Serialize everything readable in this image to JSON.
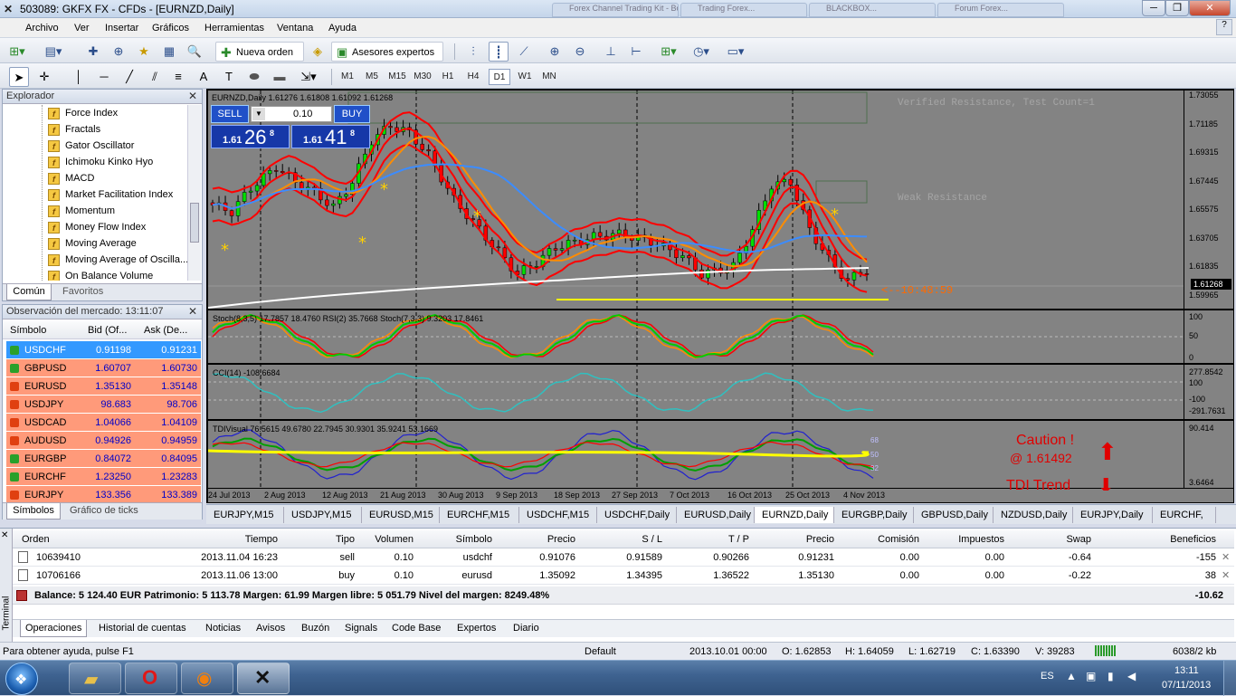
{
  "window": {
    "title": "503089: GKFX FX - CFDs - [EURNZD,Daily]",
    "bg_tabs": [
      "Forex Channel Trading Kit - Bo...",
      "Trading Forex...",
      "BLACKBOX...",
      "Forum Forex..."
    ],
    "controls": {
      "minimize": "─",
      "restore": "❐",
      "close": "✕"
    }
  },
  "menu": [
    "Archivo",
    "Ver",
    "Insertar",
    "Gráficos",
    "Herramientas",
    "Ventana",
    "Ayuda"
  ],
  "toolbar": {
    "new_order": "Nueva orden",
    "expert_advisors": "Asesores expertos"
  },
  "timeframes": [
    "M1",
    "M5",
    "M15",
    "M30",
    "H1",
    "H4",
    "D1",
    "W1",
    "MN"
  ],
  "active_timeframe": "D1",
  "navigator": {
    "title": "Explorador",
    "items": [
      "Force Index",
      "Fractals",
      "Gator Oscillator",
      "Ichimoku Kinko Hyo",
      "MACD",
      "Market Facilitation Index",
      "Momentum",
      "Money Flow Index",
      "Moving Average",
      "Moving Average of Oscilla...",
      "On Balance Volume"
    ],
    "tabs": [
      "Común",
      "Favoritos"
    ]
  },
  "market_watch": {
    "title": "Observación del mercado: 13:11:07",
    "headers": {
      "symbol": "Símbolo",
      "bid": "Bid (Of...",
      "ask": "Ask (De..."
    },
    "rows": [
      {
        "symbol": "USDCHF",
        "bid": "0.91198",
        "ask": "0.91231",
        "dir": "up",
        "selected": true
      },
      {
        "symbol": "GBPUSD",
        "bid": "1.60707",
        "ask": "1.60730",
        "dir": "up"
      },
      {
        "symbol": "EURUSD",
        "bid": "1.35130",
        "ask": "1.35148",
        "dir": "down"
      },
      {
        "symbol": "USDJPY",
        "bid": "98.683",
        "ask": "98.706",
        "dir": "down"
      },
      {
        "symbol": "USDCAD",
        "bid": "1.04066",
        "ask": "1.04109",
        "dir": "down"
      },
      {
        "symbol": "AUDUSD",
        "bid": "0.94926",
        "ask": "0.94959",
        "dir": "down"
      },
      {
        "symbol": "EURGBP",
        "bid": "0.84072",
        "ask": "0.84095",
        "dir": "up"
      },
      {
        "symbol": "EURCHF",
        "bid": "1.23250",
        "ask": "1.23283",
        "dir": "up"
      },
      {
        "symbol": "EURJPY",
        "bid": "133.356",
        "ask": "133.389",
        "dir": "down"
      }
    ],
    "tabs": [
      "Símbolos",
      "Gráfico de ticks"
    ]
  },
  "chart": {
    "header": "EURNZD,Daily  1.61276 1.61808 1.61092 1.61268",
    "one_click": {
      "sell": "SELL",
      "buy": "BUY",
      "lot": "0.10",
      "sell_big": "26",
      "sell_small": "1.61",
      "sell_sup": "8",
      "buy_big": "41",
      "buy_small": "1.61",
      "buy_sup": "8"
    },
    "annotations": {
      "verified_resistance": "Verified Resistance, Test Count=1",
      "weak_resistance": "Weak Resistance",
      "timer": "<--10:48:59",
      "caution": "Caution !",
      "caution_price": "@ 1.61492",
      "tdi_trend": "TDI Trend"
    },
    "price_axis": [
      "1.73055",
      "1.71185",
      "1.69315",
      "1.67445",
      "1.65575",
      "1.63705",
      "1.61835",
      "1.59965"
    ],
    "current_price": "1.61268",
    "stoch_label": "Stoch(8,3,5) 17.7857 18.4760  RSI(2) 35.7668  Stoch(7,3,3) 9.3203 17.8461",
    "stoch_axis": [
      "100",
      "50",
      "0"
    ],
    "cci_label": "CCI(14) -108.6684",
    "cci_axis": [
      "277.8542",
      "100",
      "-100",
      "-291.7631"
    ],
    "tdi_label": "TDIVisual 76.5615 49.6780 22.7945 30.9301 35.9241 53.1669",
    "tdi_axis": [
      "90.414",
      "3.6464"
    ],
    "tdi_levels": [
      "68",
      "50",
      "32"
    ],
    "date_axis": [
      "24 Jul 2013",
      "2 Aug 2013",
      "12 Aug 2013",
      "21 Aug 2013",
      "30 Aug 2013",
      "9 Sep 2013",
      "18 Sep 2013",
      "27 Sep 2013",
      "7 Oct 2013",
      "16 Oct 2013",
      "25 Oct 2013",
      "4 Nov 2013"
    ],
    "colors": {
      "background": "#838383",
      "bull": "#00e000",
      "bear": "#ff0000",
      "ma_fast": "#ff0000",
      "ma_mid": "#ff8c00",
      "ma_slow": "#3c8cff",
      "ma_long": "#ffffff",
      "support": "#ffff00"
    }
  },
  "chart_tabs": [
    "EURJPY,M15",
    "USDJPY,M15",
    "EURUSD,M15",
    "EURCHF,M15",
    "USDCHF,M15",
    "USDCHF,Daily",
    "EURUSD,Daily",
    "EURNZD,Daily",
    "EURGBP,Daily",
    "GBPUSD,Daily",
    "NZDUSD,Daily",
    "EURJPY,Daily",
    "EURCHF,"
  ],
  "active_chart_tab": "EURNZD,Daily",
  "orders": {
    "headers": [
      "Orden",
      "Tiempo",
      "Tipo",
      "Volumen",
      "Símbolo",
      "Precio",
      "S / L",
      "T / P",
      "Precio",
      "Comisión",
      "Impuestos",
      "Swap",
      "Beneficios"
    ],
    "rows": [
      {
        "order": "10639410",
        "time": "2013.11.04 16:23",
        "type": "sell",
        "volume": "0.10",
        "symbol": "usdchf",
        "price": "0.91076",
        "sl": "0.91589",
        "tp": "0.90266",
        "cur": "0.91231",
        "comm": "0.00",
        "tax": "0.00",
        "swap": "-0.64",
        "profit": "-155"
      },
      {
        "order": "10706166",
        "time": "2013.11.06 13:00",
        "type": "buy",
        "volume": "0.10",
        "symbol": "eurusd",
        "price": "1.35092",
        "sl": "1.34395",
        "tp": "1.36522",
        "cur": "1.35130",
        "comm": "0.00",
        "tax": "0.00",
        "swap": "-0.22",
        "profit": "38"
      }
    ],
    "balance": "Balance: 5 124.40 EUR  Patrimonio: 5 113.78  Margen: 61.99  Margen libre: 5 051.79  Nivel del margen: 8249.48%",
    "total": "-10.62",
    "side_label": "Terminal"
  },
  "terminal_tabs": [
    "Operaciones",
    "Historial de cuentas",
    "Noticias",
    "Avisos",
    "Buzón",
    "Signals",
    "Code Base",
    "Expertos",
    "Diario"
  ],
  "status": {
    "help": "Para obtener ayuda, pulse F1",
    "profile": "Default",
    "bar_time": "2013.10.01 00:00",
    "open": "O: 1.62853",
    "high": "H: 1.64059",
    "low": "L: 1.62719",
    "close": "C: 1.63390",
    "volume": "V: 39283",
    "traffic": "6038/2 kb"
  },
  "taskbar": {
    "lang": "ES",
    "time": "13:11",
    "date": "07/11/2013"
  }
}
